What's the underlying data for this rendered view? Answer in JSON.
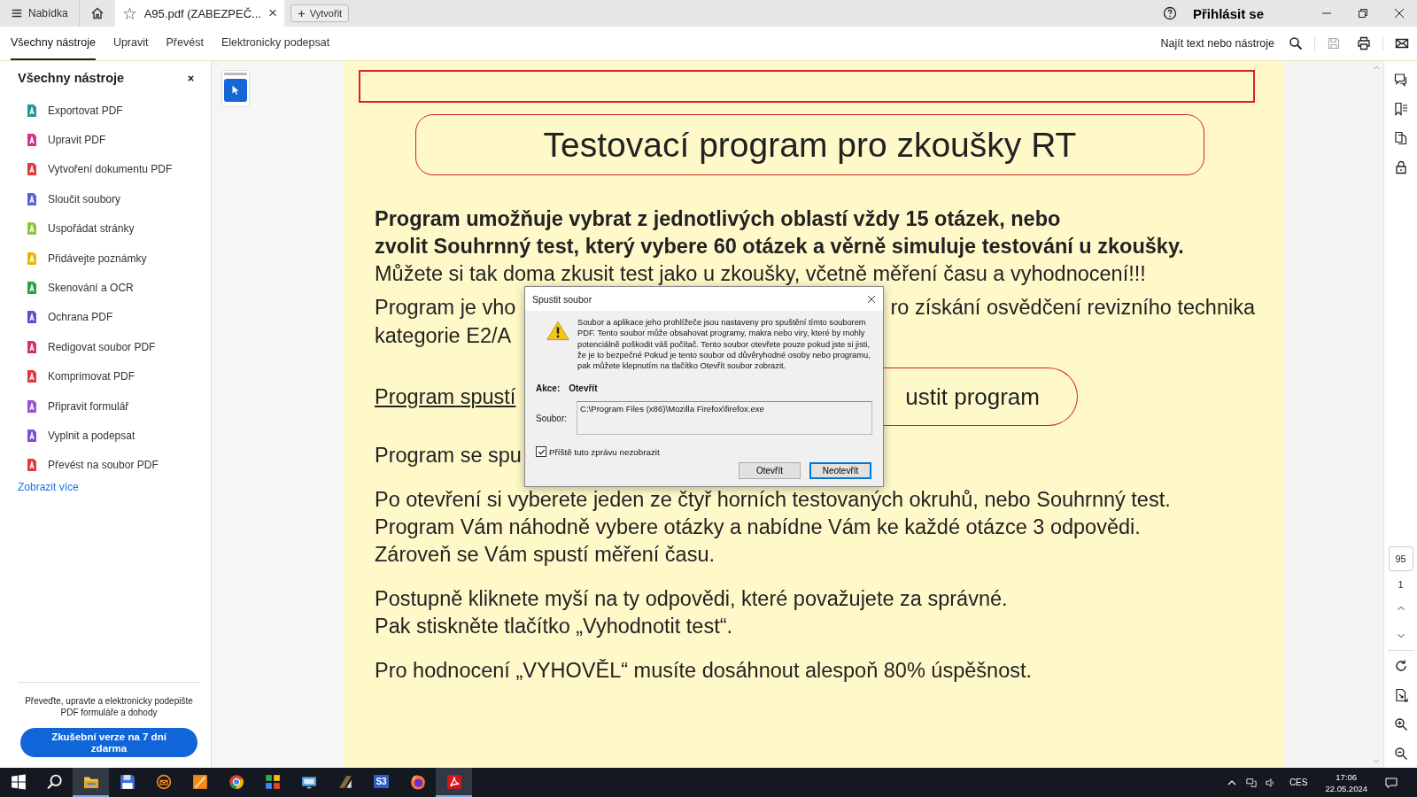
{
  "titlebar": {
    "menu": "Nabídka",
    "tab": {
      "star": "☆",
      "title": "A95.pdf (ZABEZPEČ...",
      "close": "×"
    },
    "new_button": "Vytvořit",
    "sign_in": "Přihlásit se"
  },
  "toolbar": {
    "tabs": [
      {
        "label": "Všechny nástroje",
        "selected": true
      },
      {
        "label": "Upravit",
        "selected": false
      },
      {
        "label": "Převést",
        "selected": false
      },
      {
        "label": "Elektronicky podepsat",
        "selected": false
      }
    ],
    "search": "Najít text nebo nástroje"
  },
  "sidebar": {
    "title": "Všechny nástroje",
    "items": [
      {
        "label": "Exportovat PDF",
        "color": "#1f9b8f"
      },
      {
        "label": "Upravit PDF",
        "color": "#d62f8a"
      },
      {
        "label": "Vytvoření dokumentu PDF",
        "color": "#e0393e"
      },
      {
        "label": "Sloučit soubory",
        "color": "#5a61d6"
      },
      {
        "label": "Uspořádat stránky",
        "color": "#8cc63f"
      },
      {
        "label": "Přidávejte poznámky",
        "color": "#e8b800"
      },
      {
        "label": "Skenování a OCR",
        "color": "#2e9e4f"
      },
      {
        "label": "Ochrana PDF",
        "color": "#5b4fd6"
      },
      {
        "label": "Redigovat soubor PDF",
        "color": "#d62f6a"
      },
      {
        "label": "Komprimovat PDF",
        "color": "#e0393e"
      },
      {
        "label": "Připravit formulář",
        "color": "#9b4fd6"
      },
      {
        "label": "Vyplnit a podepsat",
        "color": "#7b4fd6"
      },
      {
        "label": "Převést na soubor PDF",
        "color": "#e0393e"
      }
    ],
    "more": "Zobrazit více",
    "promo": "Převeďte, upravte a elektronicky podepište PDF formuláře a dohody",
    "trial_button": "Zkušební verze na 7 dní zdarma"
  },
  "document": {
    "title": "Testovací program pro zkoušky RT",
    "paragraphs": [
      {
        "lines": [
          {
            "kind": "bold",
            "text": "Program umožňuje vybrat z jednotlivých oblastí vždy 15 otázek, nebo"
          },
          {
            "kind": "bold",
            "text": "zvolit Souhrnný test, který vybere 60 otázek a věrně simuluje testování u zkoušky."
          },
          {
            "kind": "text",
            "text": "Můžete si tak doma zkusit test jako u zkoušky, včetně měření času a vyhodnocení!!!"
          }
        ]
      },
      {
        "lines": [
          {
            "kind": "split",
            "left": "Program je vho",
            "right": "ro získání osvědčení revizního technika"
          },
          {
            "kind": "text",
            "text": "kategorie E2/A"
          }
        ]
      },
      {
        "lines": [
          {
            "kind": "link",
            "left": "Program spustí",
            "right": "ustit program"
          }
        ]
      },
      {
        "lines": [
          {
            "kind": "text",
            "text": "Program se spu"
          }
        ]
      },
      {
        "lines": [
          {
            "kind": "text",
            "text": "Po otevření si vyberete jeden ze čtyř horních testovaných okruhů, nebo Souhrnný test."
          },
          {
            "kind": "text",
            "text": "Program Vám náhodně vybere otázky a nabídne Vám ke každé otázce 3 odpovědi."
          },
          {
            "kind": "text",
            "text": "Zároveň se Vám spustí měření času."
          }
        ]
      },
      {
        "lines": [
          {
            "kind": "text",
            "text": "Postupně kliknete myší na ty odpovědi, které považujete za správné."
          },
          {
            "kind": "text",
            "text": "Pak stiskněte tlačítko „Vyhodnotit test“."
          }
        ]
      },
      {
        "lines": [
          {
            "kind": "text",
            "text": "Pro hodnocení „VYHOVĚL“ musíte dosáhnout alespoň 80% úspěšnost."
          }
        ]
      }
    ]
  },
  "dialog": {
    "title": "Spustit soubor",
    "message": "Soubor a aplikace jeho prohlížeče jsou nastaveny pro spuštění tímto souborem PDF. Tento soubor může obsahovat programy, makra nebo viry, které by mohly potenciálně poškodit váš počítač. Tento soubor otevřete pouze pokud jste si jisti, že je to bezpečné Pokud je tento soubor od důvěryhodné osoby nebo programu, pak můžete klepnutím na tlačítko Otevřít soubor zobrazit.",
    "action_label": "Akce:",
    "action_value": "Otevřít",
    "file_label": "Soubor:",
    "file_value": "C:\\Program Files (x86)\\Mozilla Firefox\\firefox.exe",
    "checkbox": {
      "label": "Příště tuto zprávu nezobrazit",
      "checked": true
    },
    "buttons": [
      {
        "label": "Otevřít",
        "selected": false
      },
      {
        "label": "Neotevřít",
        "selected": true
      }
    ]
  },
  "pager": {
    "page": "95",
    "total": "1"
  },
  "taskbar": {
    "apps": [
      {
        "kind": "start",
        "selected": false
      },
      {
        "kind": "search",
        "selected": false
      },
      {
        "kind": "folder",
        "selected": true
      },
      {
        "kind": "floppy",
        "selected": false
      },
      {
        "kind": "mail",
        "selected": false
      },
      {
        "kind": "orange",
        "selected": false
      },
      {
        "kind": "chrome",
        "selected": false
      },
      {
        "kind": "puzzle",
        "selected": false
      },
      {
        "kind": "screen",
        "selected": false
      },
      {
        "kind": "tool",
        "selected": false
      },
      {
        "kind": "label",
        "label": "S3",
        "selected": false
      },
      {
        "kind": "firefox",
        "selected": false
      },
      {
        "kind": "acrobat",
        "selected": true
      }
    ],
    "language": "CES",
    "time": "17:06",
    "date": "22.05.2024"
  }
}
